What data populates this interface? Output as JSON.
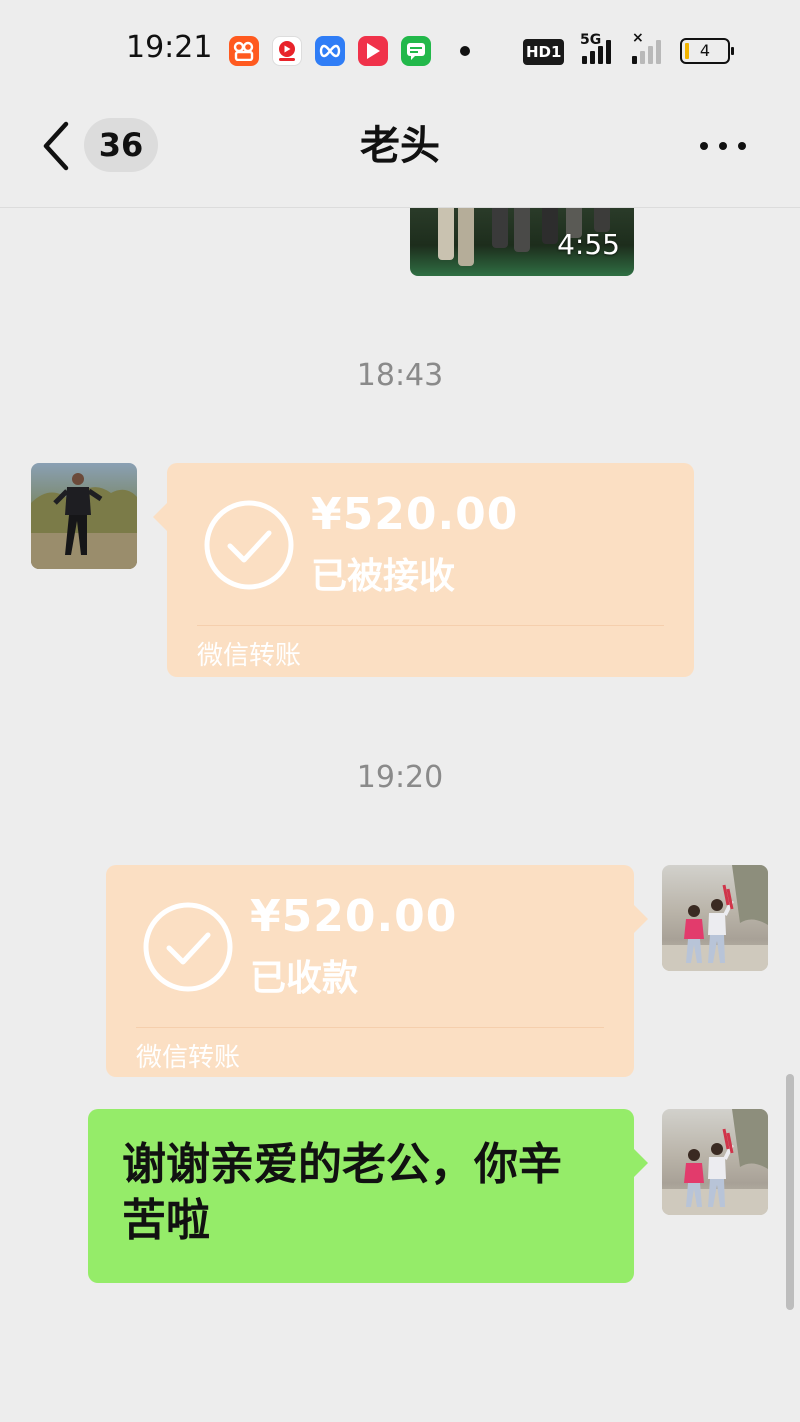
{
  "status_bar": {
    "time": "19:21",
    "apps": [
      "kuaishou-app-icon",
      "video-app-icon",
      "infinity-app-icon",
      "play-app-icon",
      "message-app-icon"
    ],
    "hd_label": "HD1",
    "network_label": "5G",
    "battery_level": "4",
    "battery_color": "#f2b400"
  },
  "nav": {
    "unread_count": "36",
    "title": "老头"
  },
  "messages": {
    "video": {
      "duration": "4:55"
    },
    "time_1": "18:43",
    "transfer_received_by_him": {
      "amount": "¥520.00",
      "status": "已被接收",
      "source": "微信转账"
    },
    "time_2": "19:20",
    "transfer_collected_by_me": {
      "amount": "¥520.00",
      "status": "已收款",
      "source": "微信转账"
    },
    "text_message": "谢谢亲爱的老公，你辛苦啦"
  },
  "colors": {
    "background": "#ededed",
    "transfer_bubble": "#fbdfc3",
    "sent_bubble": "#95ec69"
  }
}
